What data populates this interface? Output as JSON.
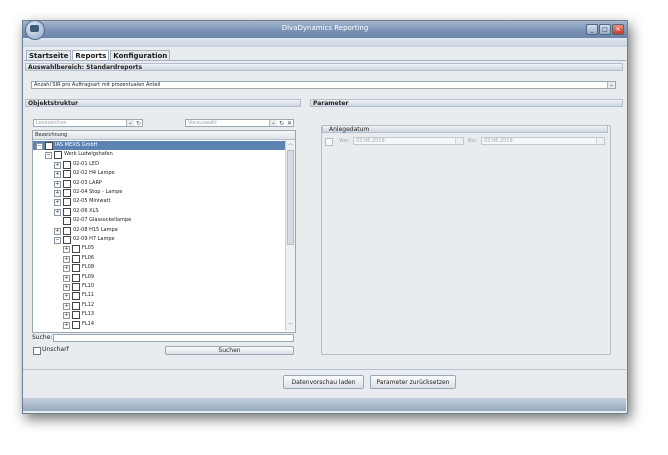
{
  "window": {
    "title": "DivaDynamics Reporting",
    "controls": [
      "_",
      "□",
      "✕"
    ]
  },
  "tabs": [
    "Startseite",
    "Reports",
    "Konfiguration"
  ],
  "report_section": {
    "header": "Auswahlbereich: Standardreports",
    "selected_report": "Anzahl SIR pro Auftragsart mit prozentualen Anteil"
  },
  "objektstruktur": {
    "header": "Objektstruktur",
    "bookmark_placeholder": "Lesezeichen",
    "preselect_placeholder": "Vorauswahl",
    "column_header": "Bezeichnung",
    "tree": [
      {
        "label": "IAS MEXIS GmbH",
        "level": 0,
        "toggle": "−",
        "selected": true
      },
      {
        "label": "Werk Ludwigshafen",
        "level": 1,
        "toggle": "−"
      },
      {
        "label": "02-01 LED",
        "level": 2,
        "toggle": "+"
      },
      {
        "label": "02-02 H4 Lampe",
        "level": 2,
        "toggle": "+"
      },
      {
        "label": "02-03 LARP",
        "level": 2,
        "toggle": "+"
      },
      {
        "label": "02-04 Stop - Lampe",
        "level": 2,
        "toggle": "+"
      },
      {
        "label": "02-05 Miniwatt",
        "level": 2,
        "toggle": "+"
      },
      {
        "label": "02-06 XLS",
        "level": 2,
        "toggle": "+"
      },
      {
        "label": "02-07 Glassockellampe",
        "level": 2,
        "toggle": ""
      },
      {
        "label": "02-08 H15 Lampe",
        "level": 2,
        "toggle": "+"
      },
      {
        "label": "02-09 H7 Lampe",
        "level": 2,
        "toggle": "−"
      },
      {
        "label": "FL05",
        "level": 3,
        "toggle": "+"
      },
      {
        "label": "FL06",
        "level": 3,
        "toggle": "+"
      },
      {
        "label": "FL08",
        "level": 3,
        "toggle": "+"
      },
      {
        "label": "FL09",
        "level": 3,
        "toggle": "+"
      },
      {
        "label": "FL10",
        "level": 3,
        "toggle": "+"
      },
      {
        "label": "FL11",
        "level": 3,
        "toggle": "+"
      },
      {
        "label": "FL12",
        "level": 3,
        "toggle": "+"
      },
      {
        "label": "FL13",
        "level": 3,
        "toggle": "+"
      },
      {
        "label": "FL14",
        "level": 3,
        "toggle": "+"
      }
    ],
    "search_label": "Suche:",
    "search_value": "",
    "fuzzy_label": "Unscharf",
    "search_button": "Suchen"
  },
  "parameter": {
    "header": "Parameter",
    "group_title": "Anlegedatum",
    "from_label": "Von:",
    "from_value": "03.06.2019",
    "to_label": "Bis:",
    "to_value": "03.06.2019"
  },
  "footer": {
    "preview_button": "Datenvorschau laden",
    "reset_button": "Parameter zurücksetzen"
  },
  "icons": {
    "refresh": "refresh-icon",
    "clear": "clear-icon",
    "dropdown": "chevron-down-icon",
    "logo": "app-logo-icon"
  },
  "colors": {
    "selection": "#5c83b4",
    "titlebar": "#7b93b6"
  }
}
